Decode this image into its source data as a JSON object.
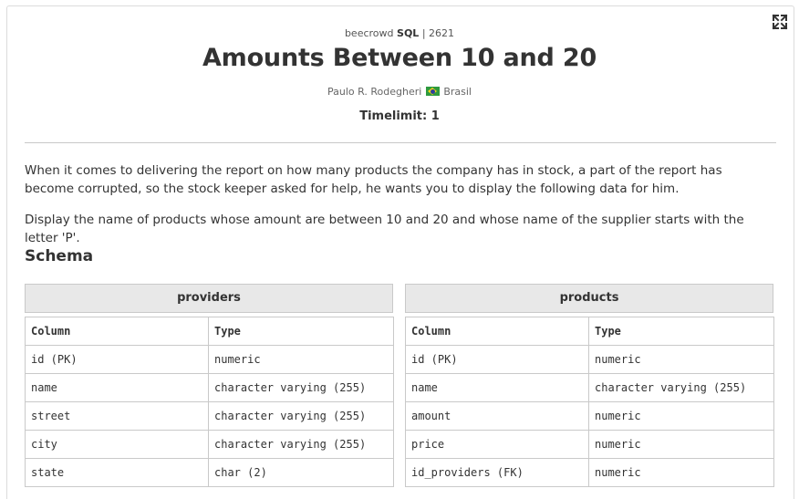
{
  "problem": {
    "source": "beecrowd",
    "category": "SQL",
    "separator": "|",
    "number": "2621",
    "title": "Amounts Between 10 and 20",
    "author": "Paulo R. Rodegheri",
    "country": "Brasil",
    "timelimit": "Timelimit: 1"
  },
  "description": {
    "p1": "When it comes to delivering the report on how many products the company has in stock, a part of the report has become corrupted, so the stock keeper asked for help, he wants you to display the following data for him.",
    "p2": "Display the name of products whose amount are between 10 and 20 and whose name of the supplier starts with the letter 'P'."
  },
  "schema": {
    "heading": "Schema",
    "column_header": "Column",
    "type_header": "Type",
    "tables": [
      {
        "name": "providers",
        "rows": [
          {
            "column": "id (PK)",
            "type": "numeric"
          },
          {
            "column": "name",
            "type": "character varying (255)"
          },
          {
            "column": "street",
            "type": "character varying (255)"
          },
          {
            "column": "city",
            "type": "character varying (255)"
          },
          {
            "column": "state",
            "type": "char (2)"
          }
        ]
      },
      {
        "name": "products",
        "rows": [
          {
            "column": "id (PK)",
            "type": "numeric"
          },
          {
            "column": "name",
            "type": "character varying (255)"
          },
          {
            "column": "amount",
            "type": "numeric"
          },
          {
            "column": "price",
            "type": "numeric"
          },
          {
            "column": "id_providers (FK)",
            "type": "numeric"
          }
        ]
      }
    ]
  },
  "icons": {
    "expand": "expand-icon",
    "flag": "brazil-flag-icon"
  }
}
